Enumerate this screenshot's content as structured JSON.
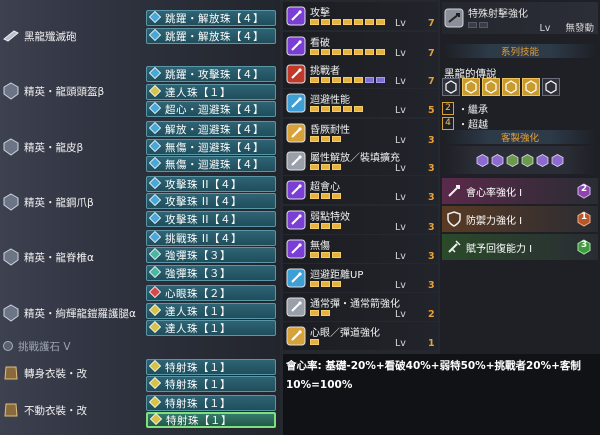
{
  "armor": [
    {
      "name": "黑龍殲滅砲",
      "decorations": [
        "跳躍・解放珠【４】",
        "跳躍・解放珠【４】"
      ]
    },
    {
      "name": "精英・龍頭頭盔β",
      "decorations": [
        "跳躍・攻擊珠【４】",
        "達人珠【１】",
        "超心・迴避珠【４】"
      ]
    },
    {
      "name": "精英・龍皮β",
      "decorations": [
        "解放・迴避珠【４】",
        "無傷・迴避珠【４】",
        "無傷・迴避珠【４】"
      ]
    },
    {
      "name": "精英・龍鋼爪β",
      "decorations": [
        "攻擊珠 II【４】",
        "攻擊珠 II【４】",
        "攻擊珠 II【４】"
      ]
    },
    {
      "name": "精英・龍脊椎α",
      "decorations": [
        "挑戰珠 II【４】",
        "強彈珠【３】",
        "強彈珠【３】"
      ]
    },
    {
      "name": "精英・絢輝龍鎧羅護腿α",
      "decorations": [
        "心眼珠【２】",
        "達人珠【１】",
        "達人珠【１】"
      ]
    },
    {
      "name": "轉身衣裝・改",
      "decorations": [
        "特射珠【１】",
        "特射珠【１】"
      ]
    },
    {
      "name": "不動衣裝・改",
      "decorations": [
        "特射珠【１】",
        "特射珠【１】"
      ]
    }
  ],
  "charm": "挑戰護石 V",
  "skills": [
    {
      "name": "攻擊",
      "lv_label": "Lv",
      "level": "7",
      "filled": 7,
      "decor": 0,
      "max": 7,
      "icon": "sword-icon",
      "color": "#7a3dd6"
    },
    {
      "name": "看破",
      "lv_label": "Lv",
      "level": "7",
      "filled": 7,
      "decor": 0,
      "max": 7,
      "icon": "eye-icon",
      "color": "#7a3dd6"
    },
    {
      "name": "挑戰者",
      "lv_label": "Lv",
      "level": "7",
      "filled": 5,
      "decor": 2,
      "max": 7,
      "icon": "challenger-icon",
      "color": "#c0392b"
    },
    {
      "name": "迴避性能",
      "lv_label": "Lv",
      "level": "5",
      "filled": 5,
      "decor": 0,
      "max": 5,
      "icon": "evade-icon",
      "color": "#3e9fd6"
    },
    {
      "name": "昏厥耐性",
      "lv_label": "Lv",
      "level": "3",
      "filled": 3,
      "decor": 0,
      "max": 3,
      "icon": "stun-resist-icon",
      "color": "#d8a23a"
    },
    {
      "name": "屬性解放／裝填擴充",
      "lv_label": "Lv",
      "level": "3",
      "filled": 3,
      "decor": 0,
      "max": 3,
      "icon": "free-elem-icon",
      "color": "#9aa0aa"
    },
    {
      "name": "超會心",
      "lv_label": "Lv",
      "level": "3",
      "filled": 3,
      "decor": 0,
      "max": 3,
      "icon": "crit-boost-icon",
      "color": "#7a3dd6"
    },
    {
      "name": "弱點特效",
      "lv_label": "Lv",
      "level": "3",
      "filled": 3,
      "decor": 0,
      "max": 3,
      "icon": "weakness-icon",
      "color": "#7a3dd6"
    },
    {
      "name": "無傷",
      "lv_label": "Lv",
      "level": "3",
      "filled": 3,
      "decor": 0,
      "max": 3,
      "icon": "peak-icon",
      "color": "#7a3dd6"
    },
    {
      "name": "迴避距離UP",
      "lv_label": "Lv",
      "level": "3",
      "filled": 3,
      "decor": 0,
      "max": 3,
      "icon": "evade-extend-icon",
      "color": "#3e9fd6"
    },
    {
      "name": "通常彈・通常箭強化",
      "lv_label": "Lv",
      "level": "2",
      "filled": 2,
      "decor": 0,
      "max": 2,
      "icon": "normal-shot-icon",
      "color": "#9aa0aa"
    },
    {
      "name": "心眼／彈道強化",
      "lv_label": "Lv",
      "level": "1",
      "filled": 1,
      "decor": 0,
      "max": 1,
      "icon": "mind-eye-icon",
      "color": "#d8a23a"
    }
  ],
  "special": {
    "name": "特殊射擊強化",
    "lv_label": "Lv",
    "status": "無發動",
    "filled": 0,
    "max": 2
  },
  "series": {
    "header": "系列技能",
    "set_name": "黑龍的傳說",
    "icons_total": 6,
    "icons_active": 4,
    "bonuses": [
      {
        "count": "2",
        "label": "・繼承"
      },
      {
        "count": "4",
        "label": "・超越"
      }
    ]
  },
  "custom": {
    "header": "客製強化",
    "gem_count": 6,
    "augments": [
      {
        "name": "會心率強化 I",
        "badge": "2",
        "bg": "#5a2a4a",
        "badge_color": "#8e44ad"
      },
      {
        "name": "防禦力強化 I",
        "badge": "1",
        "bg": "#5a3a24",
        "badge_color": "#b8562a"
      },
      {
        "name": "賦予回復能力 I",
        "badge": "3",
        "bg": "#2a4a2a",
        "badge_color": "#3e9a3e"
      }
    ]
  },
  "formula": "會心率:  基礎-20%+看破40%+弱特50%+挑戰者20%+客制10%=100%"
}
